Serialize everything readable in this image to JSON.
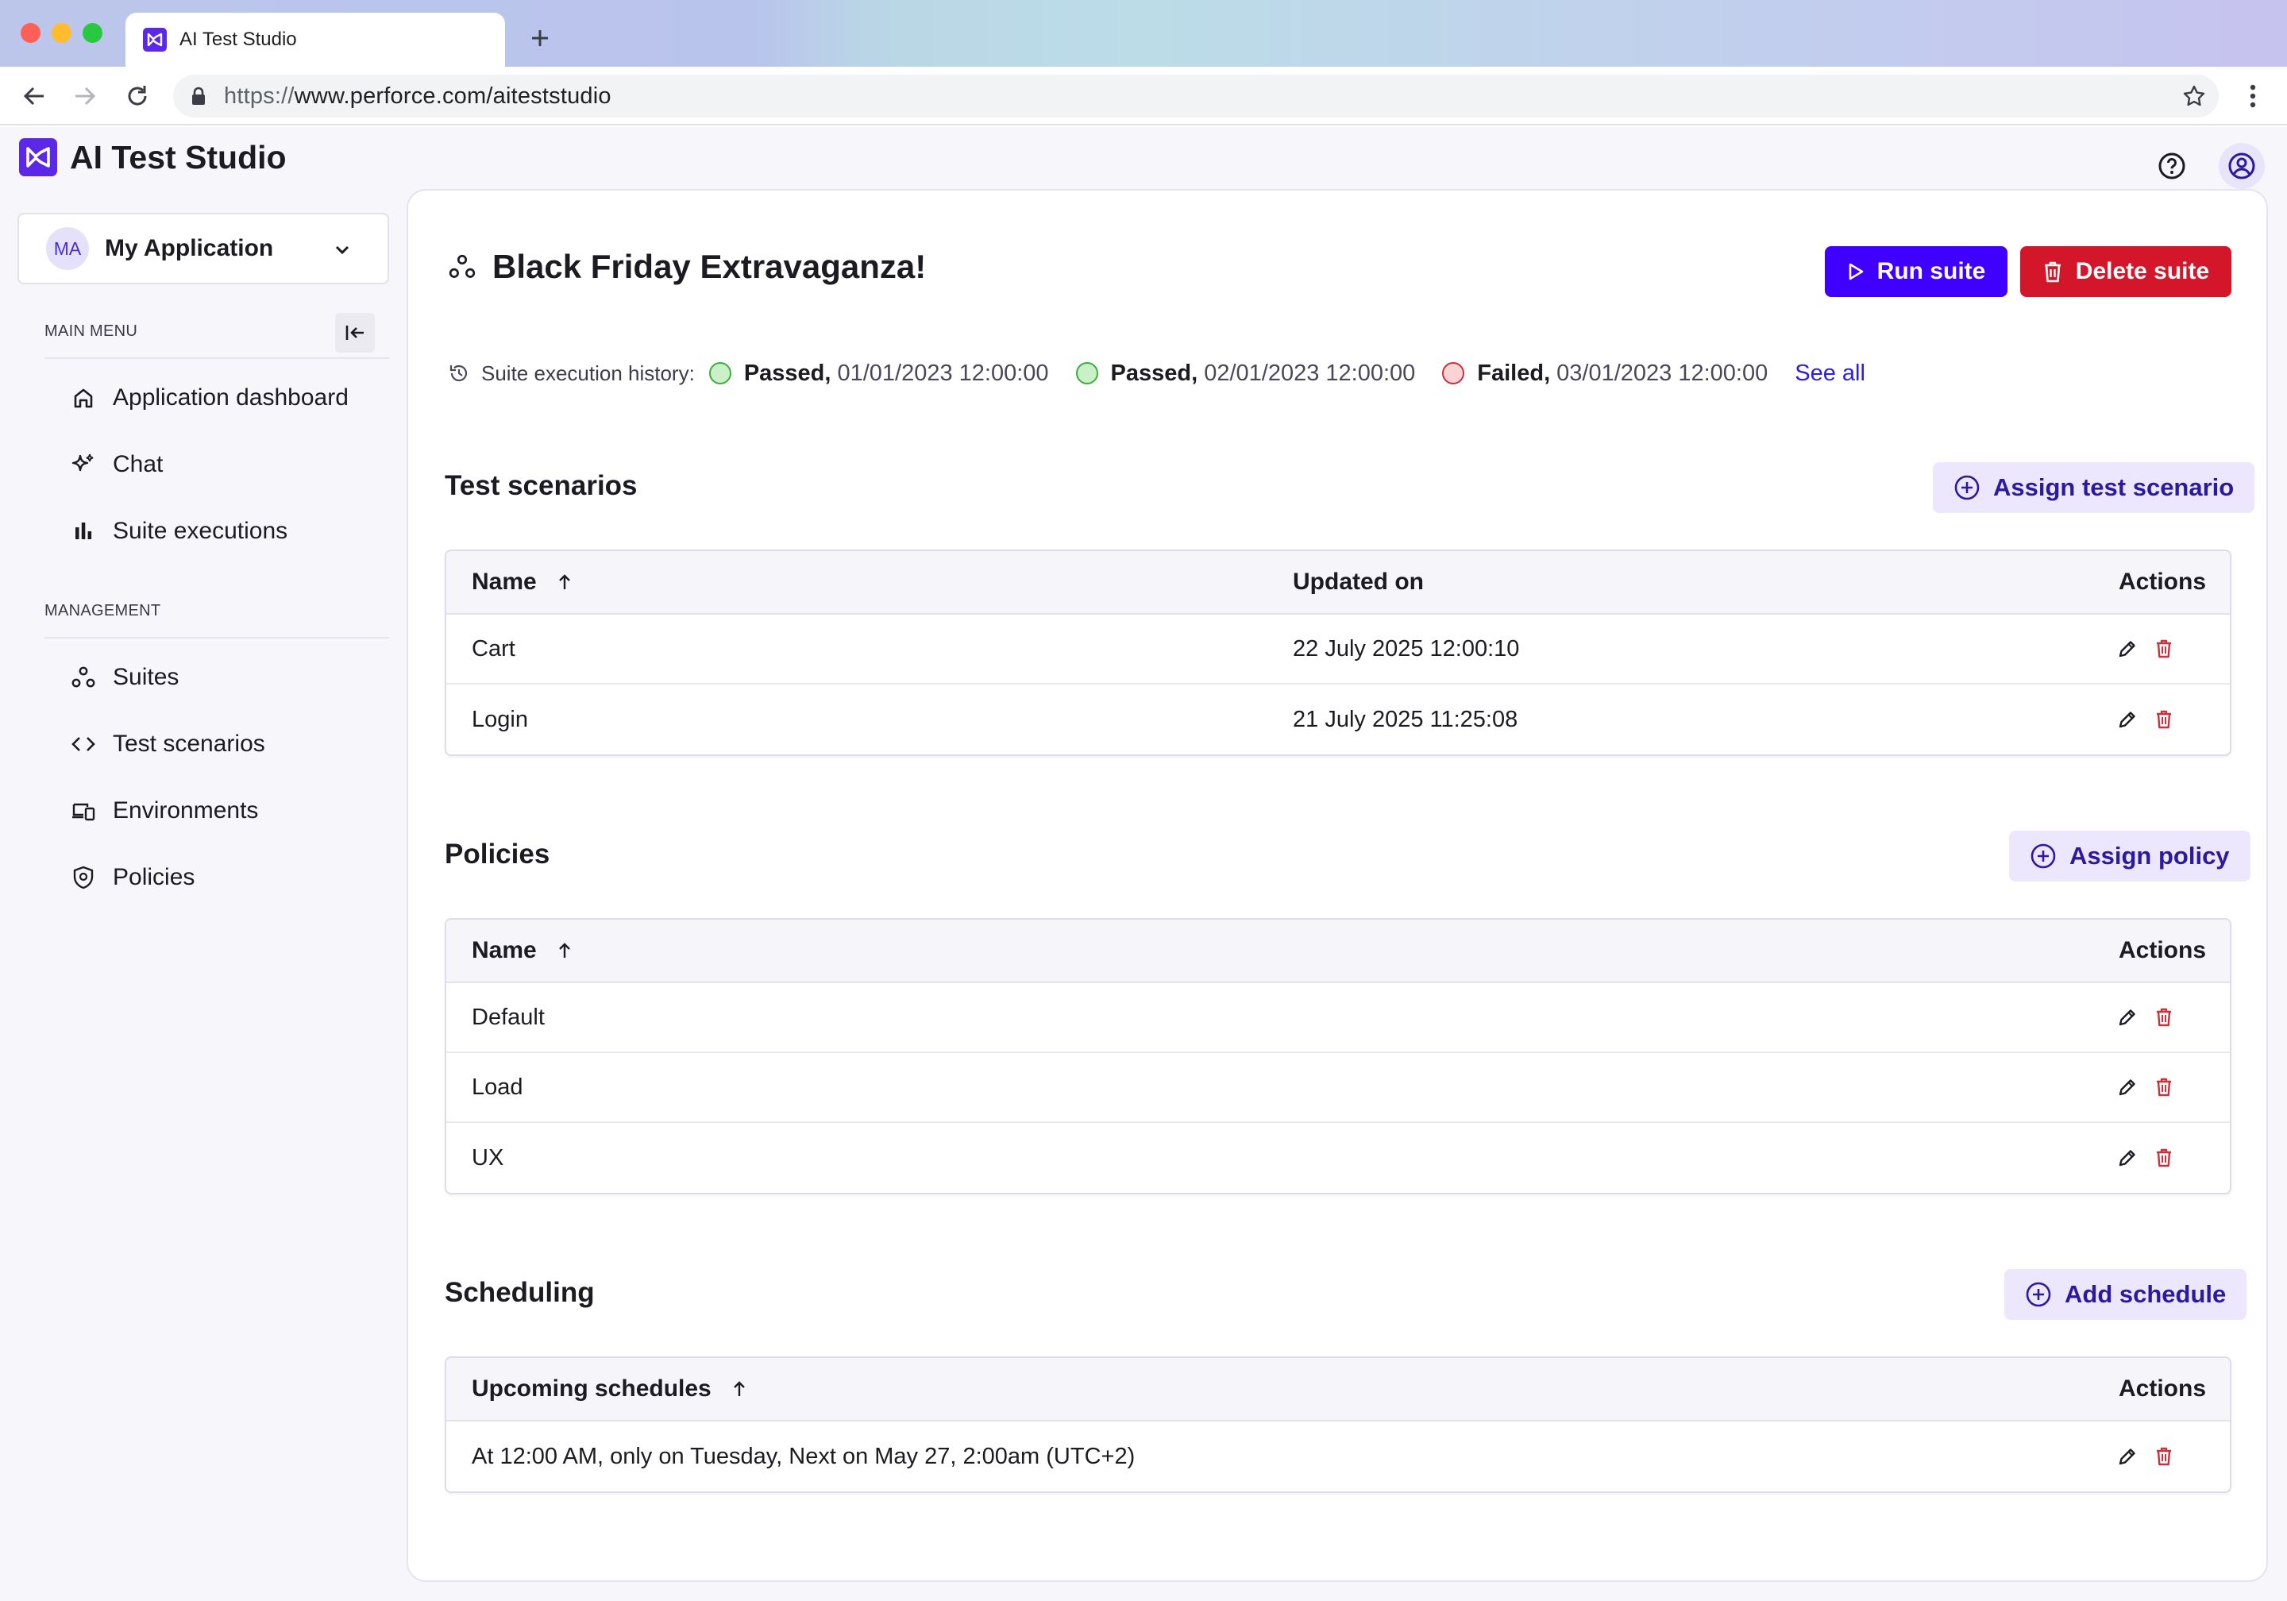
{
  "browser": {
    "tab_title": "AI Test Studio",
    "url_scheme": "https://",
    "url_rest": "www.perforce.com/aiteststudio"
  },
  "app": {
    "title": "AI Test Studio"
  },
  "sidebar": {
    "app_selector": {
      "initials": "MA",
      "label": "My Application"
    },
    "main_menu_label": "MAIN MENU",
    "management_label": "MANAGEMENT",
    "main_items": [
      {
        "label": "Application dashboard",
        "icon": "home-icon"
      },
      {
        "label": "Chat",
        "icon": "sparkle-icon"
      },
      {
        "label": "Suite executions",
        "icon": "bar-chart-icon"
      }
    ],
    "management_items": [
      {
        "label": "Suites",
        "icon": "suites-icon"
      },
      {
        "label": "Test scenarios",
        "icon": "code-icon"
      },
      {
        "label": "Environments",
        "icon": "devices-icon"
      },
      {
        "label": "Policies",
        "icon": "shield-icon"
      }
    ]
  },
  "main": {
    "title": "Black Friday Extravaganza!",
    "run_label": "Run suite",
    "delete_label": "Delete suite",
    "history_label": "Suite execution history:",
    "history": [
      {
        "status": "Passed,",
        "date": "01/01/2023 12:00:00",
        "state": "pass"
      },
      {
        "status": "Passed,",
        "date": "02/01/2023 12:00:00",
        "state": "pass"
      },
      {
        "status": "Failed,",
        "date": "03/01/2023 12:00:00",
        "state": "fail"
      }
    ],
    "see_all": "See all",
    "scenarios": {
      "title": "Test scenarios",
      "action": "Assign test scenario",
      "col_name": "Name",
      "col_updated": "Updated on",
      "col_actions": "Actions",
      "rows": [
        {
          "name": "Cart",
          "updated": "22 July 2025 12:00:10"
        },
        {
          "name": "Login",
          "updated": "21 July 2025 11:25:08"
        }
      ]
    },
    "policies": {
      "title": "Policies",
      "action": "Assign policy",
      "col_name": "Name",
      "col_actions": "Actions",
      "rows": [
        {
          "name": "Default"
        },
        {
          "name": "Load"
        },
        {
          "name": "UX"
        }
      ]
    },
    "scheduling": {
      "title": "Scheduling",
      "action": "Add schedule",
      "col_name": "Upcoming schedules",
      "col_actions": "Actions",
      "rows": [
        {
          "name": "At 12:00 AM, only on Tuesday, Next on May 27, 2:00am (UTC+2)"
        }
      ]
    }
  },
  "colors": {
    "primary": "#4000ff",
    "danger": "#d4162a",
    "accent_soft": "#ece7fd",
    "pass": "#3cae3c",
    "fail": "#c8323f"
  }
}
